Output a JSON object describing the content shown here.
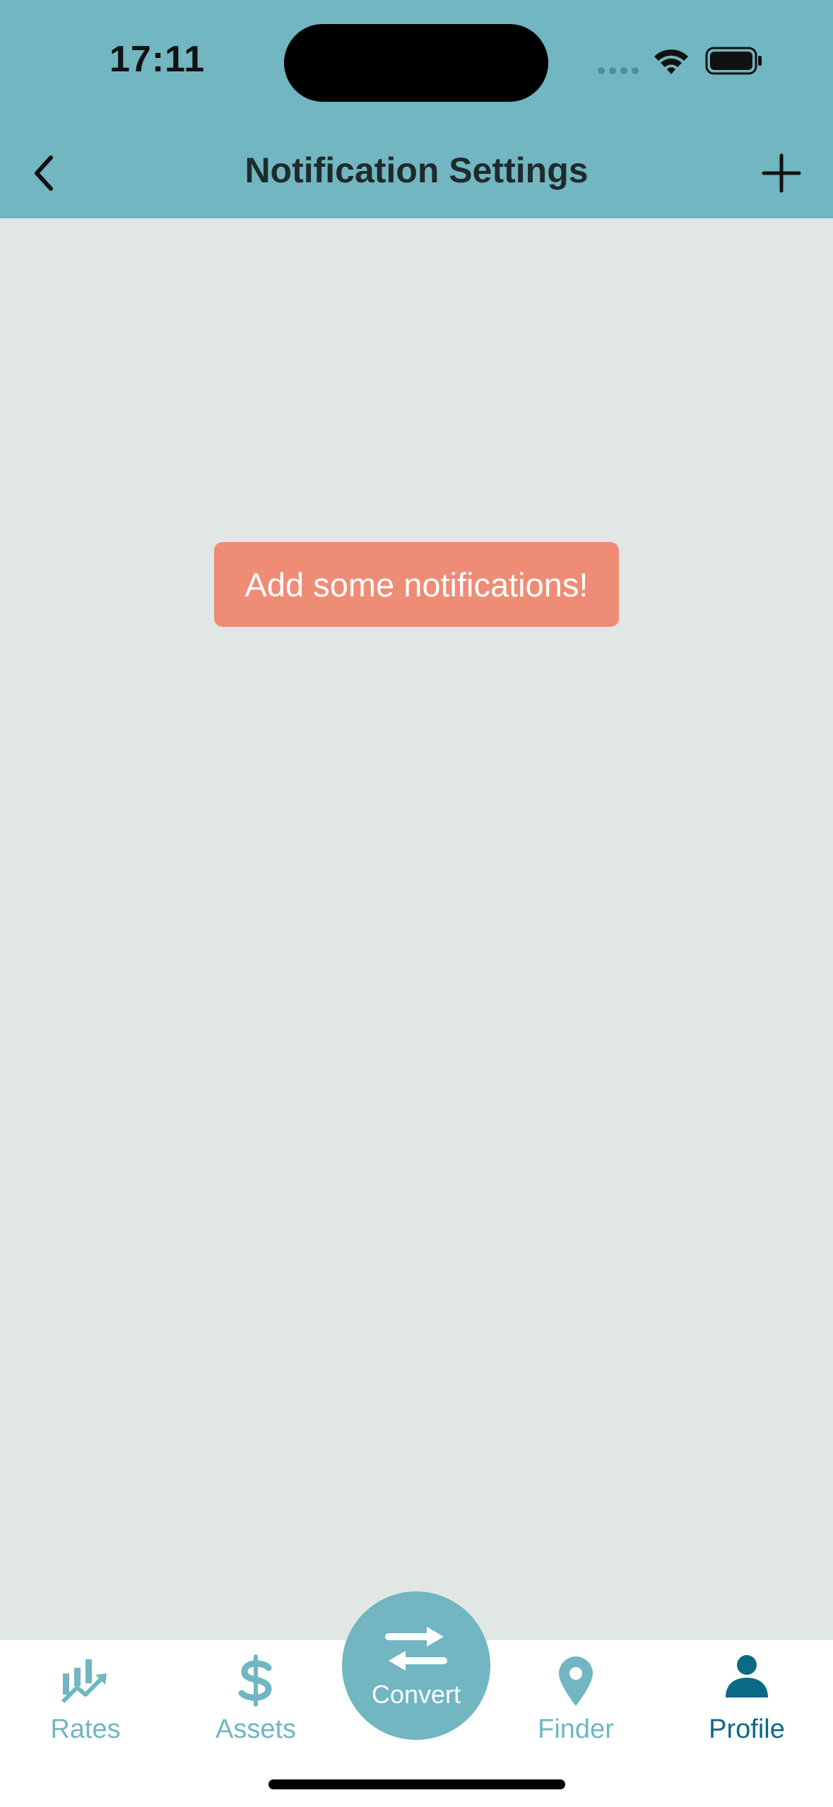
{
  "status_bar": {
    "time": "17:11"
  },
  "header": {
    "title": "Notification Settings",
    "back_icon": "chevron-left-icon",
    "add_icon": "plus-icon"
  },
  "main": {
    "empty_message": "Add some notifications!"
  },
  "tab_bar": {
    "active_tab": "Profile",
    "tabs": [
      {
        "label": "Rates",
        "icon": "chart-trend-icon"
      },
      {
        "label": "Assets",
        "icon": "dollar-icon"
      },
      {
        "label": "Convert",
        "icon": "swap-arrows-icon"
      },
      {
        "label": "Finder",
        "icon": "map-pin-icon"
      },
      {
        "label": "Profile",
        "icon": "person-icon"
      }
    ]
  },
  "colors": {
    "header_bg": "#71b6c1",
    "page_bg": "#e1e7e4",
    "message_bg": "#ef8c76",
    "tab_inactive": "#71b6c1",
    "tab_active": "#0b6985"
  }
}
